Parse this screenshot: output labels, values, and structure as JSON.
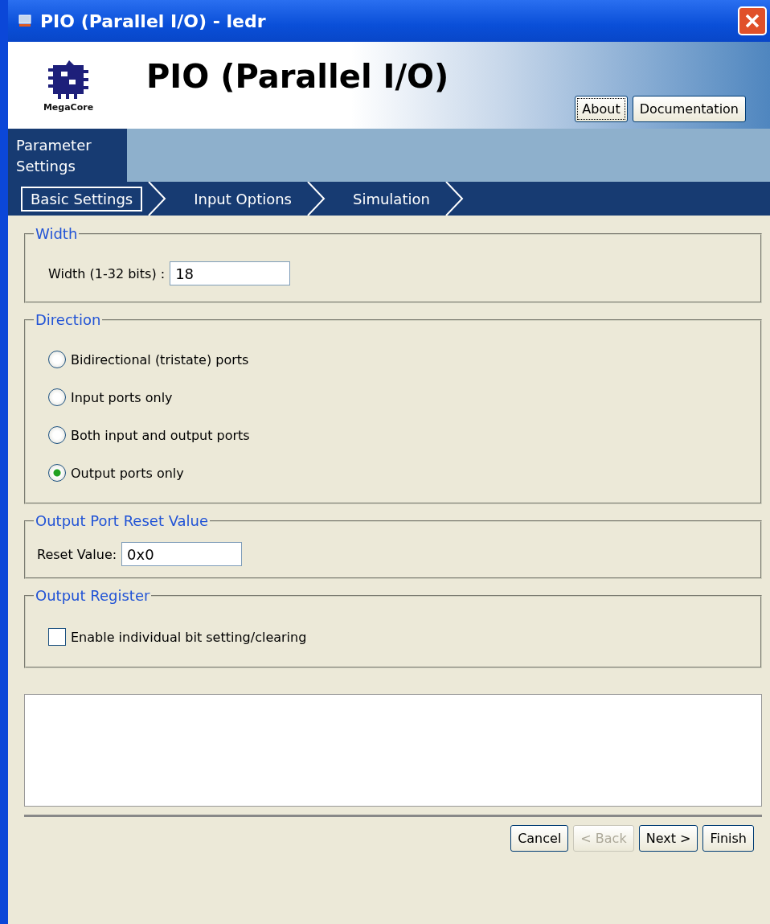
{
  "window": {
    "title": "PIO (Parallel I/O) - ledr"
  },
  "header": {
    "logo_text": "MegaCore",
    "title": "PIO (Parallel I/O)",
    "buttons": [
      {
        "label": "About",
        "focused": true
      },
      {
        "label": "Documentation",
        "focused": false
      }
    ]
  },
  "tabs": [
    {
      "label": "Parameter Settings",
      "selected": true
    }
  ],
  "steps": [
    {
      "label": "Basic Settings",
      "selected": true
    },
    {
      "label": "Input Options",
      "selected": false
    },
    {
      "label": "Simulation",
      "selected": false
    }
  ],
  "groups": [
    {
      "title": "Width",
      "kind": "field",
      "label": "Width (1-32 bits) :",
      "value": "18"
    },
    {
      "title": "Direction",
      "kind": "radios",
      "options": [
        {
          "label": "Bidirectional (tristate) ports",
          "selected": false
        },
        {
          "label": "Input ports only",
          "selected": false
        },
        {
          "label": "Both input and output ports",
          "selected": false
        },
        {
          "label": "Output ports only",
          "selected": true
        }
      ]
    },
    {
      "title": "Output Port Reset Value",
      "kind": "field",
      "label": "Reset Value:",
      "value": "0x0"
    },
    {
      "title": "Output Register",
      "kind": "checkbox",
      "label": "Enable individual bit setting/clearing",
      "checked": false
    }
  ],
  "footer_buttons": [
    {
      "label": "Cancel",
      "disabled": false
    },
    {
      "label": "< Back",
      "disabled": true
    },
    {
      "label": "Next >",
      "disabled": false
    },
    {
      "label": "Finish",
      "disabled": false
    }
  ]
}
